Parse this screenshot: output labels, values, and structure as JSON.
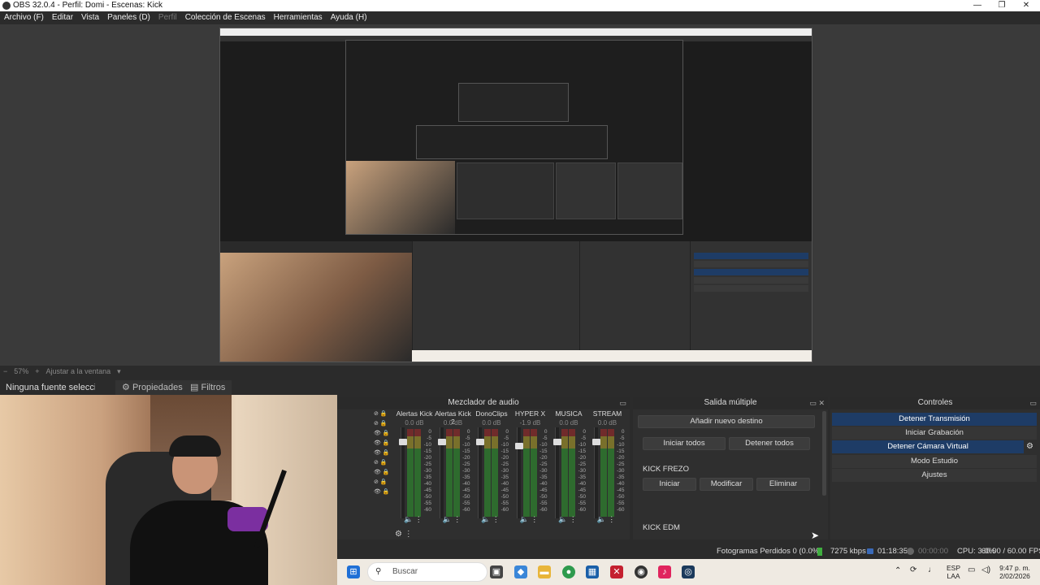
{
  "window": {
    "title": "OBS 32.0.4 - Perfil: Domi - Escenas: Kick",
    "controls": [
      "—",
      "❐",
      "✕"
    ]
  },
  "menu": {
    "items": [
      "Archivo (F)",
      "Editar",
      "Vista",
      "Paneles (D)",
      "Perfil",
      "Colección de Escenas",
      "Herramientas",
      "Ayuda (H)"
    ]
  },
  "zoom": {
    "value": "57%",
    "fit_label": "Ajustar a la ventana"
  },
  "sources": {
    "none_selected": "Ninguna fuente seleccionada",
    "properties": "Propiedades",
    "filters": "Filtros"
  },
  "mixer": {
    "title": "Mezclador de audio",
    "tracks": [
      {
        "name": "Alertas Kick",
        "db": "0.0 dB",
        "level": 0.9
      },
      {
        "name": "Alertas Kick 2",
        "db": "0.0 dB",
        "level": 0.9
      },
      {
        "name": "DonoClips",
        "db": "0.0 dB",
        "level": 0.9
      },
      {
        "name": "HYPER X",
        "db": "-1.9 dB",
        "level": 0.85
      },
      {
        "name": "MUSICA",
        "db": "0.0 dB",
        "level": 0.9
      },
      {
        "name": "STREAM",
        "db": "0.0 dB",
        "level": 0.9
      }
    ],
    "scale": [
      "0",
      "-5",
      "-10",
      "-15",
      "-20",
      "-25",
      "-30",
      "-35",
      "-40",
      "-45",
      "-50",
      "-55",
      "-60"
    ]
  },
  "multi_output": {
    "title": "Salida múltiple",
    "add_label": "Añadir nuevo destino",
    "start_all": "Iniciar todos",
    "stop_all": "Detener todos",
    "destinations": [
      {
        "name": "KICK FREZO",
        "start": "Iniciar",
        "edit": "Modificar",
        "delete": "Eliminar"
      },
      {
        "name": "KICK EDM"
      }
    ]
  },
  "controls": {
    "title": "Controles",
    "stop_stream": "Detener Transmisión",
    "start_record": "Iniciar Grabación",
    "stop_vcam": "Detener Cámara Virtual",
    "studio_mode": "Modo Estudio",
    "settings": "Ajustes"
  },
  "status": {
    "dropped": "Fotogramas Perdidos 0 (0.0%)",
    "bitrate": "7275 kbps",
    "stream_time": "01:18:35",
    "record_time": "00:00:00",
    "cpu": "CPU: 3.0%",
    "fps": "60.00 / 60.00 FPS"
  },
  "taskbar": {
    "search_placeholder": "Buscar",
    "lang": "ESP",
    "layout": "LAA",
    "time": "9:47 p. m.",
    "date": "2/02/2026"
  },
  "colors": {
    "accent": "#1e3c66",
    "meter_green": "#3fae3f",
    "meter_yellow": "#c8b83a",
    "meter_red": "#b83a3a"
  }
}
